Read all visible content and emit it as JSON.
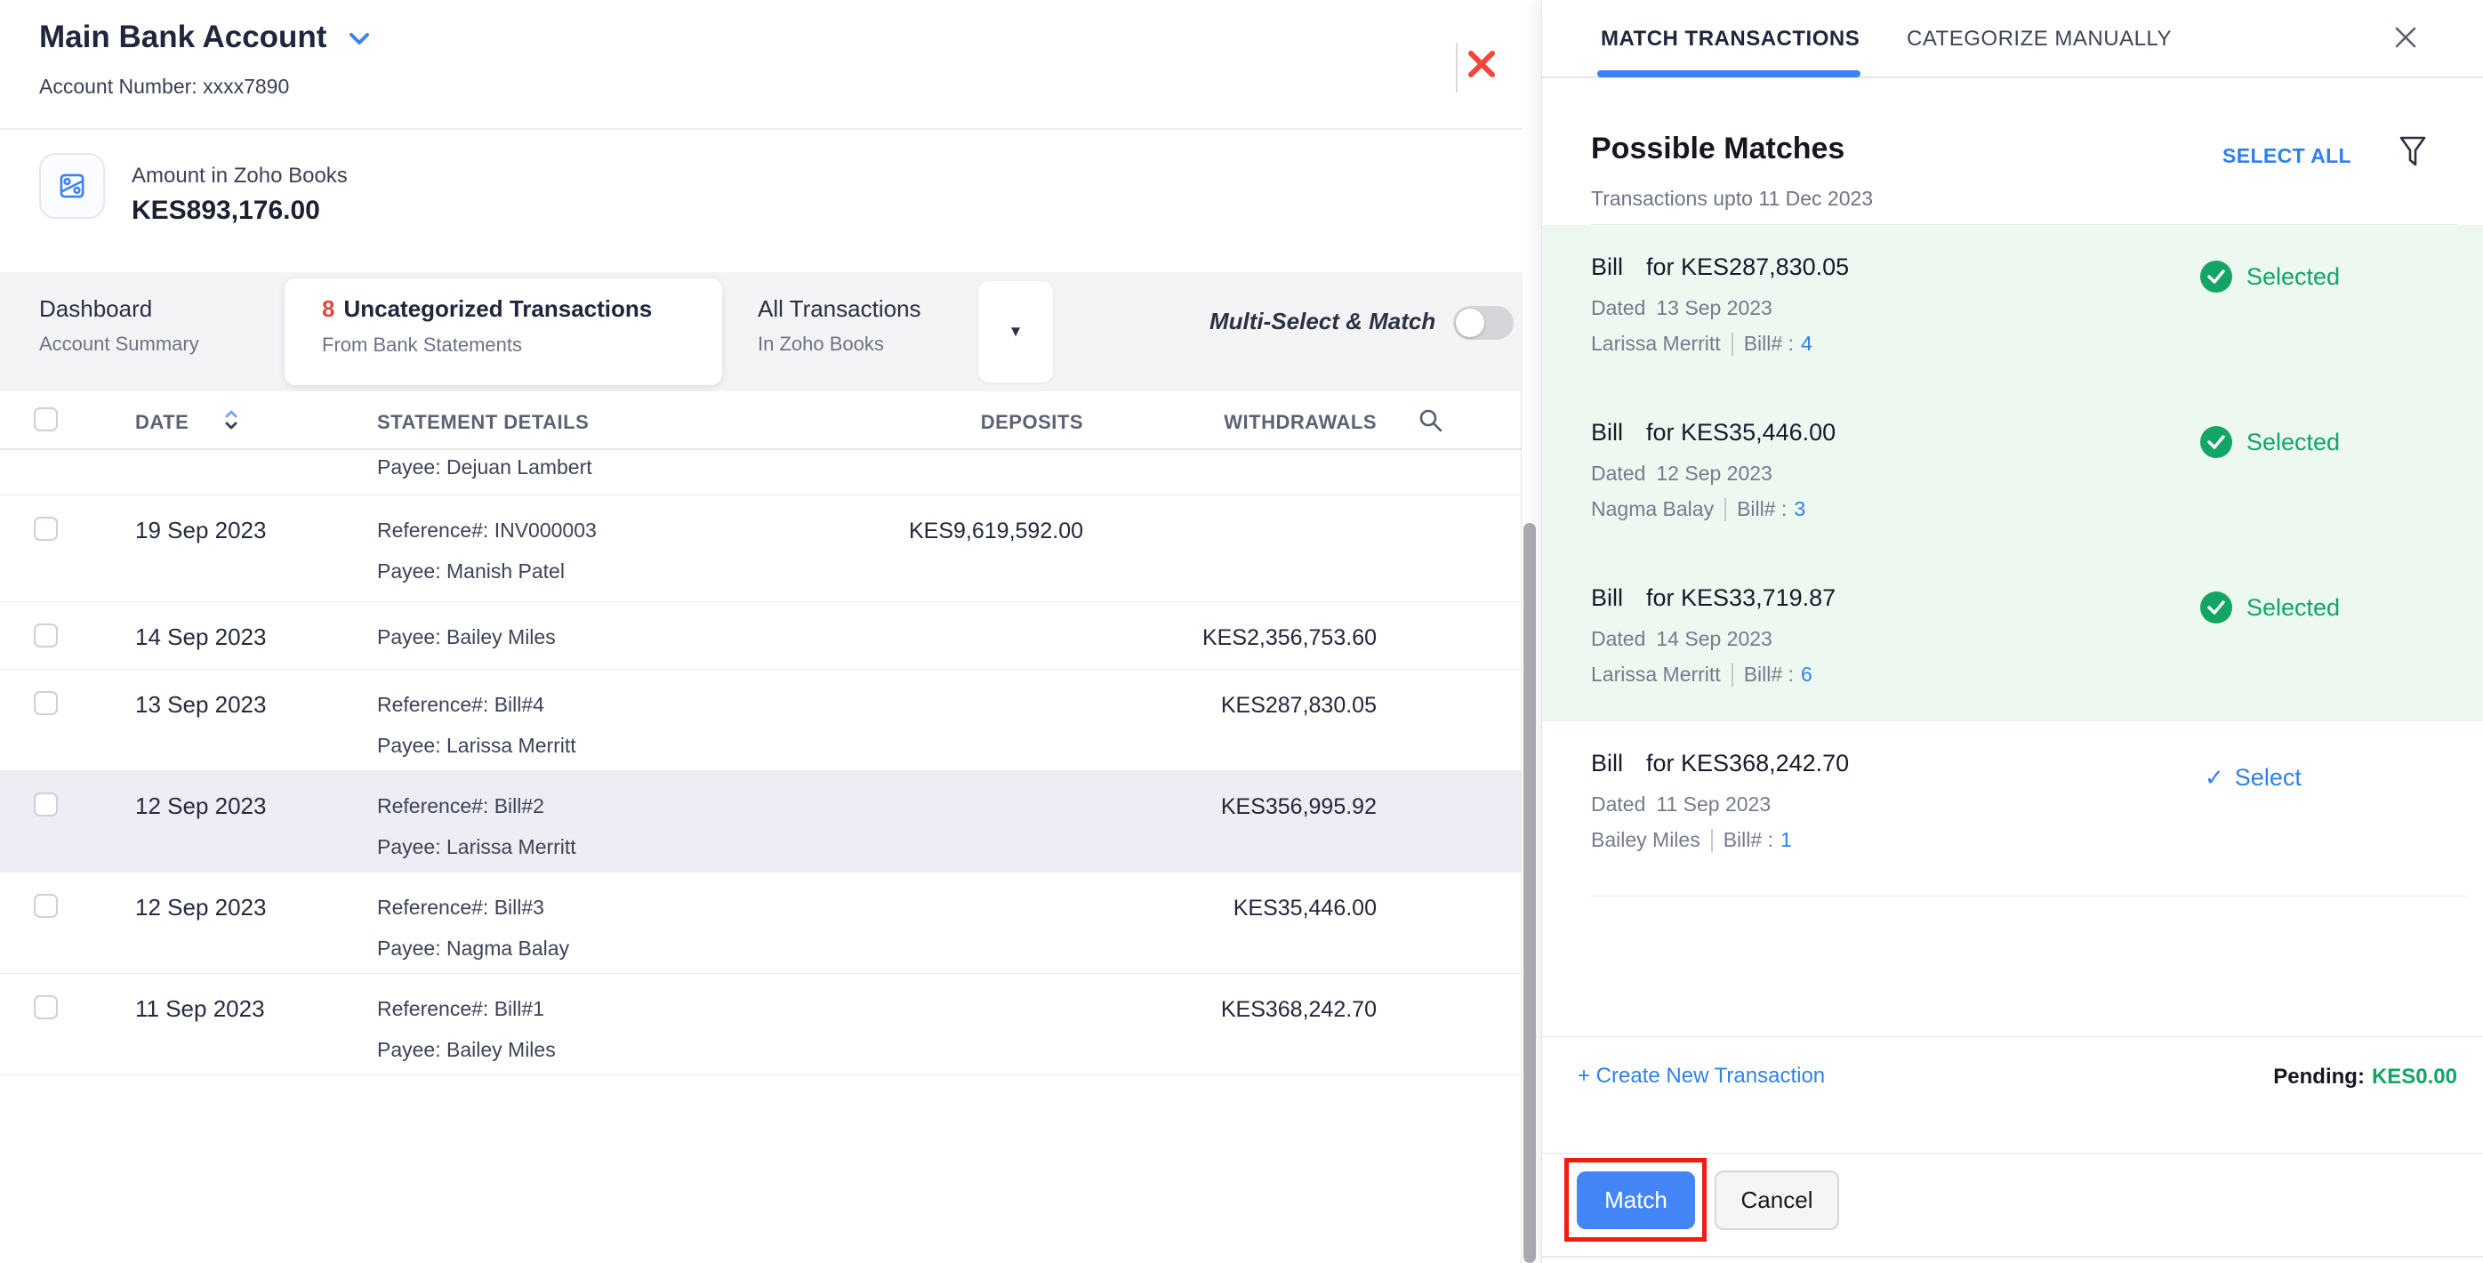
{
  "colors": {
    "accent-blue": "#2f80ed",
    "brand-blue": "#3b82f6",
    "button-blue": "#4486f7",
    "green": "#12a564",
    "green-bg": "#edf8f1",
    "red": "#f0463c",
    "annotation-red": "#ee1c12",
    "row-highlight": "#eeedf6",
    "text-dark": "#21263c",
    "text-gray": "#6f7587"
  },
  "header": {
    "title": "Main Bank Account",
    "account_number": "Account Number: xxxx7890"
  },
  "amount_card": {
    "label": "Amount in Zoho Books",
    "value": "KES893,176.00"
  },
  "tabs": {
    "dashboard_title": "Dashboard",
    "dashboard_subtitle": "Account Summary",
    "uncat_count": "8",
    "uncat_title": "Uncategorized Transactions",
    "uncat_subtitle": "From Bank Statements",
    "all_title": "All Transactions",
    "all_subtitle": "In Zoho Books",
    "all_caret": "▼",
    "multi_select_label": "Multi-Select & Match"
  },
  "table": {
    "headers": {
      "date": "DATE",
      "details": "STATEMENT DETAILS",
      "deposits": "DEPOSITS",
      "withdrawals": "WITHDRAWALS"
    },
    "partial_row_payee": "Payee: Dejuan Lambert",
    "rows": [
      {
        "date": "19 Sep 2023",
        "reference": "Reference#: INV000003",
        "payee": "Payee: Manish Patel",
        "deposit": "KES9,619,592.00",
        "withdrawal": "",
        "highlighted": false
      },
      {
        "date": "14 Sep 2023",
        "reference": "",
        "payee": "Payee: Bailey Miles",
        "deposit": "",
        "withdrawal": "KES2,356,753.60",
        "highlighted": false
      },
      {
        "date": "13 Sep 2023",
        "reference": "Reference#: Bill#4",
        "payee": "Payee: Larissa Merritt",
        "deposit": "",
        "withdrawal": "KES287,830.05",
        "highlighted": false
      },
      {
        "date": "12 Sep 2023",
        "reference": "Reference#: Bill#2",
        "payee": "Payee: Larissa Merritt",
        "deposit": "",
        "withdrawal": "KES356,995.92",
        "highlighted": true
      },
      {
        "date": "12 Sep 2023",
        "reference": "Reference#: Bill#3",
        "payee": "Payee: Nagma Balay",
        "deposit": "",
        "withdrawal": "KES35,446.00",
        "highlighted": false
      },
      {
        "date": "11 Sep 2023",
        "reference": "Reference#: Bill#1",
        "payee": "Payee: Bailey Miles",
        "deposit": "",
        "withdrawal": "KES368,242.70",
        "highlighted": false
      }
    ]
  },
  "panel": {
    "tab_match": "MATCH TRANSACTIONS",
    "tab_categorize": "CATEGORIZE MANUALLY",
    "heading": "Possible Matches",
    "select_all": "SELECT ALL",
    "subheading": "Transactions upto 11 Dec 2023",
    "matches": [
      {
        "type": "Bill",
        "amount": "for KES287,830.05",
        "dated_label": "Dated",
        "dated": "13 Sep 2023",
        "payee": "Larissa Merritt",
        "bill_label": "Bill# :",
        "bill_number": "4",
        "action": "Selected",
        "selected": true
      },
      {
        "type": "Bill",
        "amount": "for KES35,446.00",
        "dated_label": "Dated",
        "dated": "12 Sep 2023",
        "payee": "Nagma Balay",
        "bill_label": "Bill# :",
        "bill_number": "3",
        "action": "Selected",
        "selected": true
      },
      {
        "type": "Bill",
        "amount": "for KES33,719.87",
        "dated_label": "Dated",
        "dated": "14 Sep 2023",
        "payee": "Larissa Merritt",
        "bill_label": "Bill# :",
        "bill_number": "6",
        "action": "Selected",
        "selected": true
      },
      {
        "type": "Bill",
        "amount": "for KES368,242.70",
        "dated_label": "Dated",
        "dated": "11 Sep 2023",
        "payee": "Bailey Miles",
        "bill_label": "Bill# :",
        "bill_number": "1",
        "action": "Select",
        "selected": false
      }
    ],
    "footer": {
      "create_new": "+ Create New Transaction",
      "pending_label": "Pending:",
      "pending_value": "KES0.00"
    },
    "buttons": {
      "match": "Match",
      "cancel": "Cancel"
    }
  }
}
